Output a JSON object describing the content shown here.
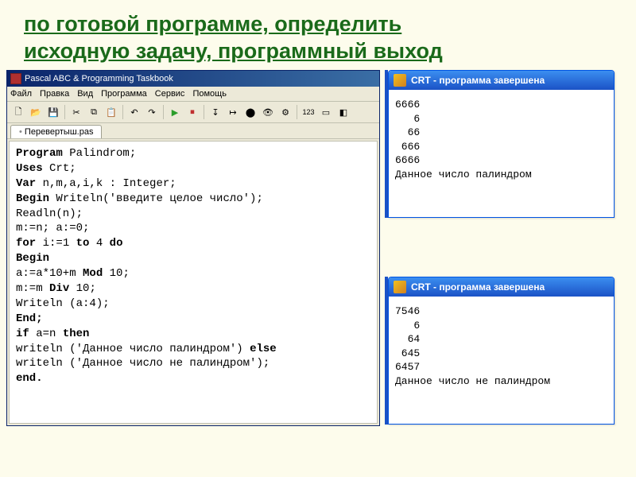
{
  "heading_line1": "по  готовой программе, определить",
  "heading_line2": "исходную задачу, программный выход",
  "ide": {
    "title": "Pascal ABC & Programming Taskbook",
    "menu": {
      "file": "Файл",
      "edit": "Правка",
      "view": "Вид",
      "program": "Программа",
      "service": "Сервис",
      "help": "Помощь"
    },
    "tab": "Перевертыш.pas",
    "code": {
      "l1a": "Program",
      "l1b": " Palindrom;",
      "l2a": "Uses",
      "l2b": " Crt;",
      "l3a": "Var",
      "l3b": " n,m,a,i,k : Integer;",
      "l4a": "Begin",
      "l4b": " Writeln('введите целое число');",
      "l5": "Readln(n);",
      "l6": "m:=n; a:=0;",
      "l7a": "for",
      "l7b": " i:=1 ",
      "l7c": "to",
      "l7d": " 4 ",
      "l7e": "do",
      "l8": "Begin",
      "l9a": "a:=a*10+m ",
      "l9b": "Mod",
      "l9c": " 10;",
      "l10a": "m:=m ",
      "l10b": "Div",
      "l10c": " 10;",
      "l11": "Writeln (a:4);",
      "l12": "End;",
      "l13a": "if",
      "l13b": " a=n ",
      "l13c": "then",
      "l14a": "writeln ('Данное число палиндром') ",
      "l14b": "else",
      "l15": "writeln ('Данное число не палиндром');",
      "l16": "end."
    }
  },
  "output": {
    "title": "CRT - программа завершена",
    "run1": {
      "l1": "6666",
      "l2": "   6",
      "l3": "  66",
      "l4": " 666",
      "l5": "6666",
      "l6": "Данное число палиндром"
    },
    "run2": {
      "l1": "7546",
      "l2": "   6",
      "l3": "  64",
      "l4": " 645",
      "l5": "6457",
      "l6": "Данное число не палиндром"
    }
  }
}
